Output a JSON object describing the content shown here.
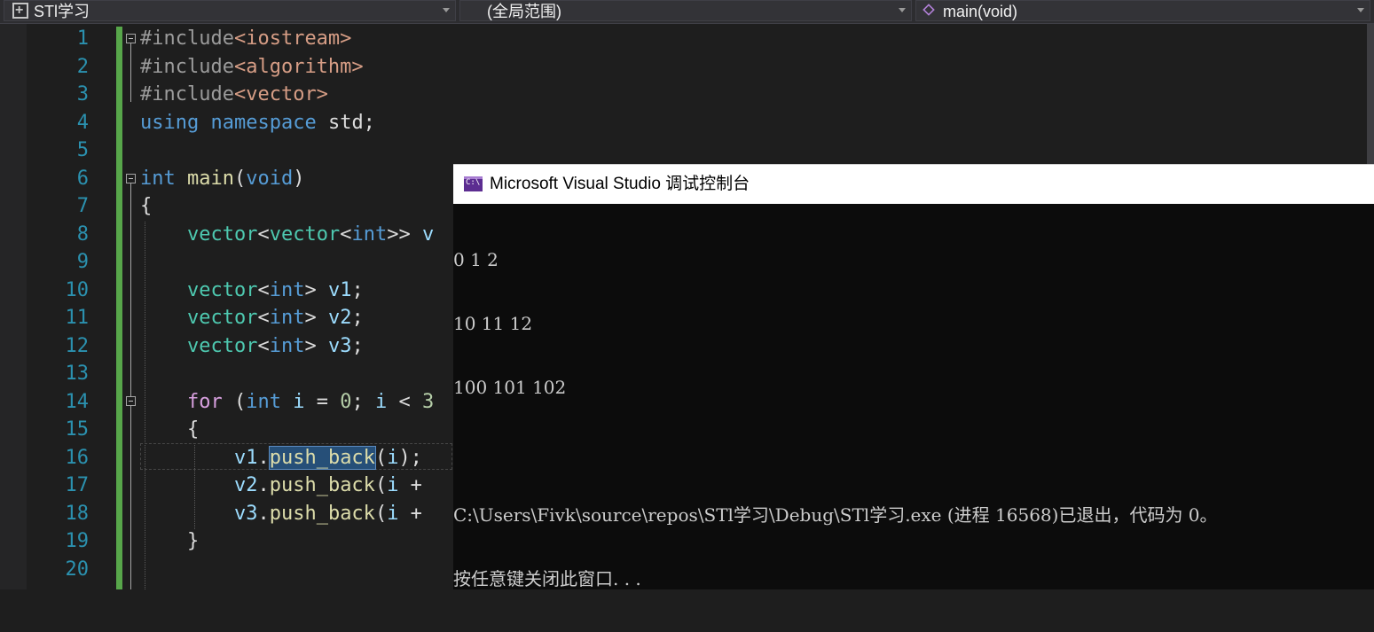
{
  "navbar": {
    "project": "STl学习",
    "scope": "(全局范围)",
    "member": "main(void)"
  },
  "line_numbers": [
    "1",
    "2",
    "3",
    "4",
    "5",
    "6",
    "7",
    "8",
    "9",
    "10",
    "11",
    "12",
    "13",
    "14",
    "15",
    "16",
    "17",
    "18",
    "19",
    "20"
  ],
  "code": {
    "l1_pp": "#include",
    "l1_inc": "<iostream>",
    "l2_pp": "#include",
    "l2_inc": "<algorithm>",
    "l3_pp": "#include",
    "l3_inc": "<vector>",
    "l4_kw1": "using",
    "l4_kw2": "namespace",
    "l4_rest": " std;",
    "l6_kw": "int",
    "l6_fn": "main",
    "l6_p1": "(",
    "l6_kw2": "void",
    "l6_p2": ")",
    "l7": "{",
    "l8_t1": "vector",
    "l8_p1": "<",
    "l8_t2": "vector",
    "l8_p2": "<",
    "l8_kw": "int",
    "l8_p3": ">> ",
    "l8_v": "v",
    "l10_t": "vector",
    "l10_p1": "<",
    "l10_kw": "int",
    "l10_p2": "> ",
    "l10_v": "v1",
    "l10_e": ";",
    "l11_t": "vector",
    "l11_p1": "<",
    "l11_kw": "int",
    "l11_p2": "> ",
    "l11_v": "v2",
    "l11_e": ";",
    "l12_t": "vector",
    "l12_p1": "<",
    "l12_kw": "int",
    "l12_p2": "> ",
    "l12_v": "v3",
    "l12_e": ";",
    "l14_ctl": "for",
    "l14_p1": " (",
    "l14_kw": "int",
    "l14_s1": " ",
    "l14_v1": "i",
    "l14_s2": " = ",
    "l14_n1": "0",
    "l14_s3": "; ",
    "l14_v2": "i",
    "l14_s4": " < ",
    "l14_n2": "3",
    "l15": "{",
    "l16_v": "v1",
    "l16_d": ".",
    "l16_fn": "push_back",
    "l16_p1": "(",
    "l16_a": "i",
    "l16_p2": ");",
    "l17_v": "v2",
    "l17_d": ".",
    "l17_fn": "push_back",
    "l17_p1": "(",
    "l17_a": "i",
    "l17_p2": " + ",
    "l18_v": "v3",
    "l18_d": ".",
    "l18_fn": "push_back",
    "l18_p1": "(",
    "l18_a": "i",
    "l18_p2": " + ",
    "l19": "}"
  },
  "console": {
    "title": "Microsoft Visual Studio 调试控制台",
    "lines": [
      "0 1 2",
      "10 11 12",
      "100 101 102",
      "",
      "C:\\Users\\Fivk\\source\\repos\\STl学习\\Debug\\STl学习.exe (进程 16568)已退出，代码为 0。",
      "按任意键关闭此窗口. . ."
    ]
  },
  "colors": {
    "editor_bg": "#1e1e1e",
    "line_number": "#2b91af",
    "keyword": "#569cd6",
    "type": "#4ec9b0",
    "function": "#dcdcaa",
    "change_bar": "#57a64a",
    "console_bg": "#0c0c0c"
  }
}
